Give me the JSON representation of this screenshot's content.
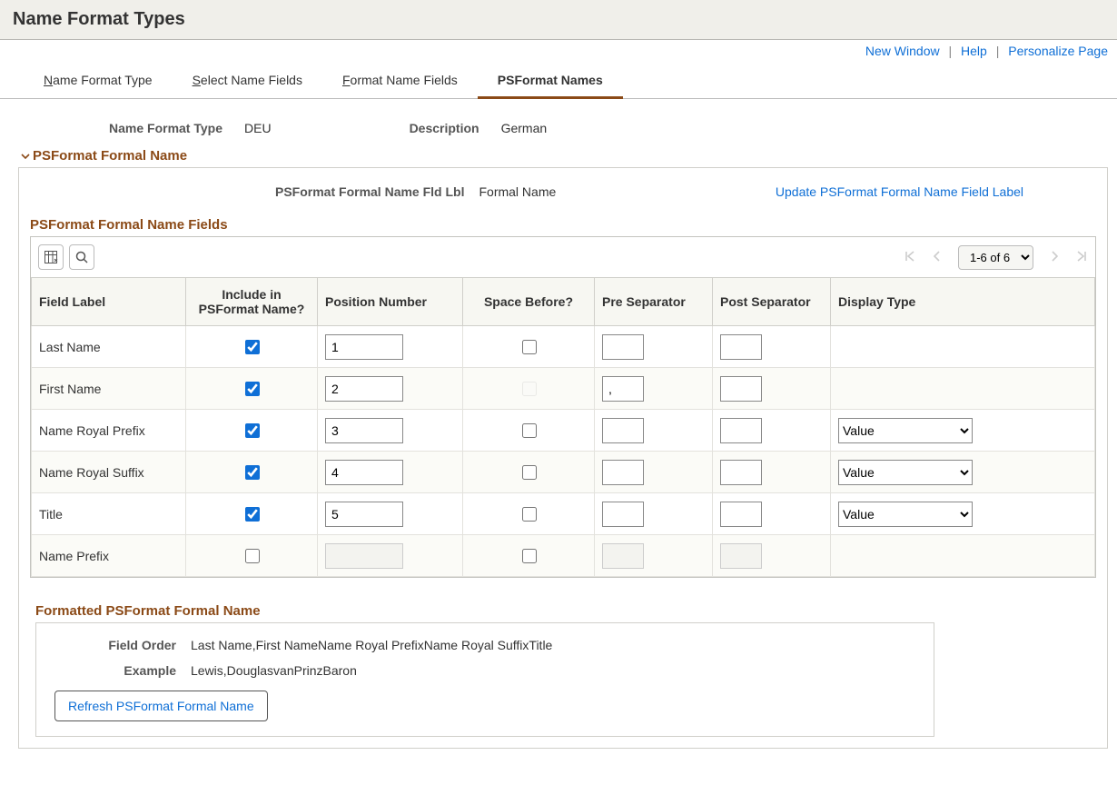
{
  "header": {
    "title": "Name Format Types"
  },
  "top_links": {
    "new_window": "New Window",
    "help": "Help",
    "personalize": "Personalize Page"
  },
  "tabs": {
    "items": [
      {
        "mnemonic": "N",
        "rest": "ame Format Type"
      },
      {
        "mnemonic": "S",
        "rest": "elect Name Fields"
      },
      {
        "mnemonic": "F",
        "rest": "ormat Name Fields"
      },
      {
        "label": "PSFormat Names"
      }
    ],
    "active_index": 3
  },
  "form": {
    "name_format_type_label": "Name Format Type",
    "name_format_type_value": "DEU",
    "description_label": "Description",
    "description_value": "German"
  },
  "section": {
    "title": "PSFormat Formal Name",
    "fld_label": "PSFormat Formal Name Fld Lbl",
    "fld_value": "Formal Name",
    "update_link": "Update PSFormat Formal Name Field Label",
    "grid_title": "PSFormat Formal Name Fields",
    "pager_text": "1-6 of 6",
    "columns": {
      "field_label": "Field Label",
      "include": "Include in PSFormat Name?",
      "position": "Position Number",
      "space_before": "Space Before?",
      "pre_sep": "Pre Separator",
      "post_sep": "Post Separator",
      "display_type": "Display Type"
    },
    "display_type_options": [
      "Value"
    ],
    "rows": [
      {
        "label": "Last Name",
        "include": true,
        "position": "1",
        "space_before": false,
        "space_disabled": false,
        "pre": "",
        "post": "",
        "display_type": null,
        "disabled": false
      },
      {
        "label": "First Name",
        "include": true,
        "position": "2",
        "space_before": false,
        "space_disabled": true,
        "pre": ",",
        "post": "",
        "display_type": null,
        "disabled": false
      },
      {
        "label": "Name Royal Prefix",
        "include": true,
        "position": "3",
        "space_before": false,
        "space_disabled": false,
        "pre": "",
        "post": "",
        "display_type": "Value",
        "disabled": false
      },
      {
        "label": "Name Royal Suffix",
        "include": true,
        "position": "4",
        "space_before": false,
        "space_disabled": false,
        "pre": "",
        "post": "",
        "display_type": "Value",
        "disabled": false
      },
      {
        "label": "Title",
        "include": true,
        "position": "5",
        "space_before": false,
        "space_disabled": false,
        "pre": "",
        "post": "",
        "display_type": "Value",
        "disabled": false
      },
      {
        "label": "Name Prefix",
        "include": false,
        "position": "",
        "space_before": false,
        "space_disabled": false,
        "pre": "",
        "post": "",
        "display_type": null,
        "disabled": true
      }
    ]
  },
  "formatted": {
    "title": "Formatted PSFormat Formal Name",
    "field_order_label": "Field Order",
    "field_order_value": "Last Name,First NameName Royal PrefixName Royal SuffixTitle",
    "example_label": "Example",
    "example_value": "Lewis,DouglasvanPrinzBaron",
    "refresh_button": "Refresh PSFormat Formal Name"
  }
}
